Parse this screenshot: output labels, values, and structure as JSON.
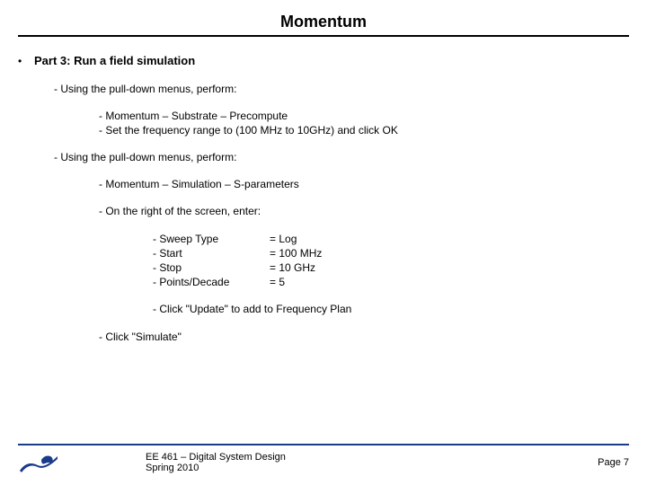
{
  "title": "Momentum",
  "main": {
    "heading": "Part 3: Run a field simulation",
    "group1": {
      "intro": "- Using the pull-down menus, perform:",
      "step1": "- Momentum – Substrate – Precompute",
      "step2": "- Set the frequency range to (100 MHz to 10GHz) and click OK"
    },
    "group2": {
      "intro": "- Using the pull-down menus, perform:",
      "step1": "- Momentum – Simulation – S-parameters",
      "onright": "- On the right of the screen, enter:",
      "params": {
        "l1": "- Sweep Type",
        "l2": "- Start",
        "l3": "- Stop",
        "l4": "- Points/Decade",
        "r1": "= Log",
        "r2": "= 100 MHz",
        "r3": "= 10 GHz",
        "r4": "= 5"
      },
      "update": "- Click \"Update\" to add to Frequency Plan",
      "simulate": "- Click \"Simulate\""
    }
  },
  "footer": {
    "course_line1": "EE 461 – Digital System Design",
    "course_line2": "Spring 2010",
    "page": "Page 7"
  }
}
